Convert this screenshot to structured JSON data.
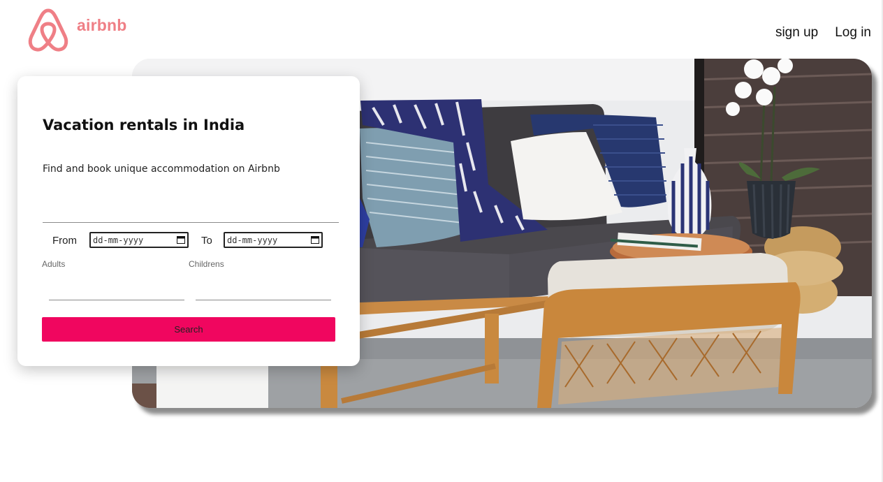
{
  "brand": {
    "name": "airbnb",
    "color": "#ef7f86",
    "logo_icon": "airbnb-belo-icon"
  },
  "nav": {
    "signup_label": "sign up",
    "login_label": "Log in"
  },
  "hero": {
    "image_description_icon": "living-room-photo"
  },
  "card": {
    "title": "Vacation rentals in India",
    "subtitle": "Find and book unique accommodation on Airbnb",
    "destination_value": "",
    "from_label": "From",
    "from_value": "dd-mm-yyyy",
    "to_label": "To",
    "to_value": "dd-mm-yyyy",
    "adults_label": "Adults",
    "adults_value": "",
    "childrens_label": "Childrens",
    "childrens_value": "",
    "search_label": "Search",
    "search_color": "#f0065f"
  }
}
